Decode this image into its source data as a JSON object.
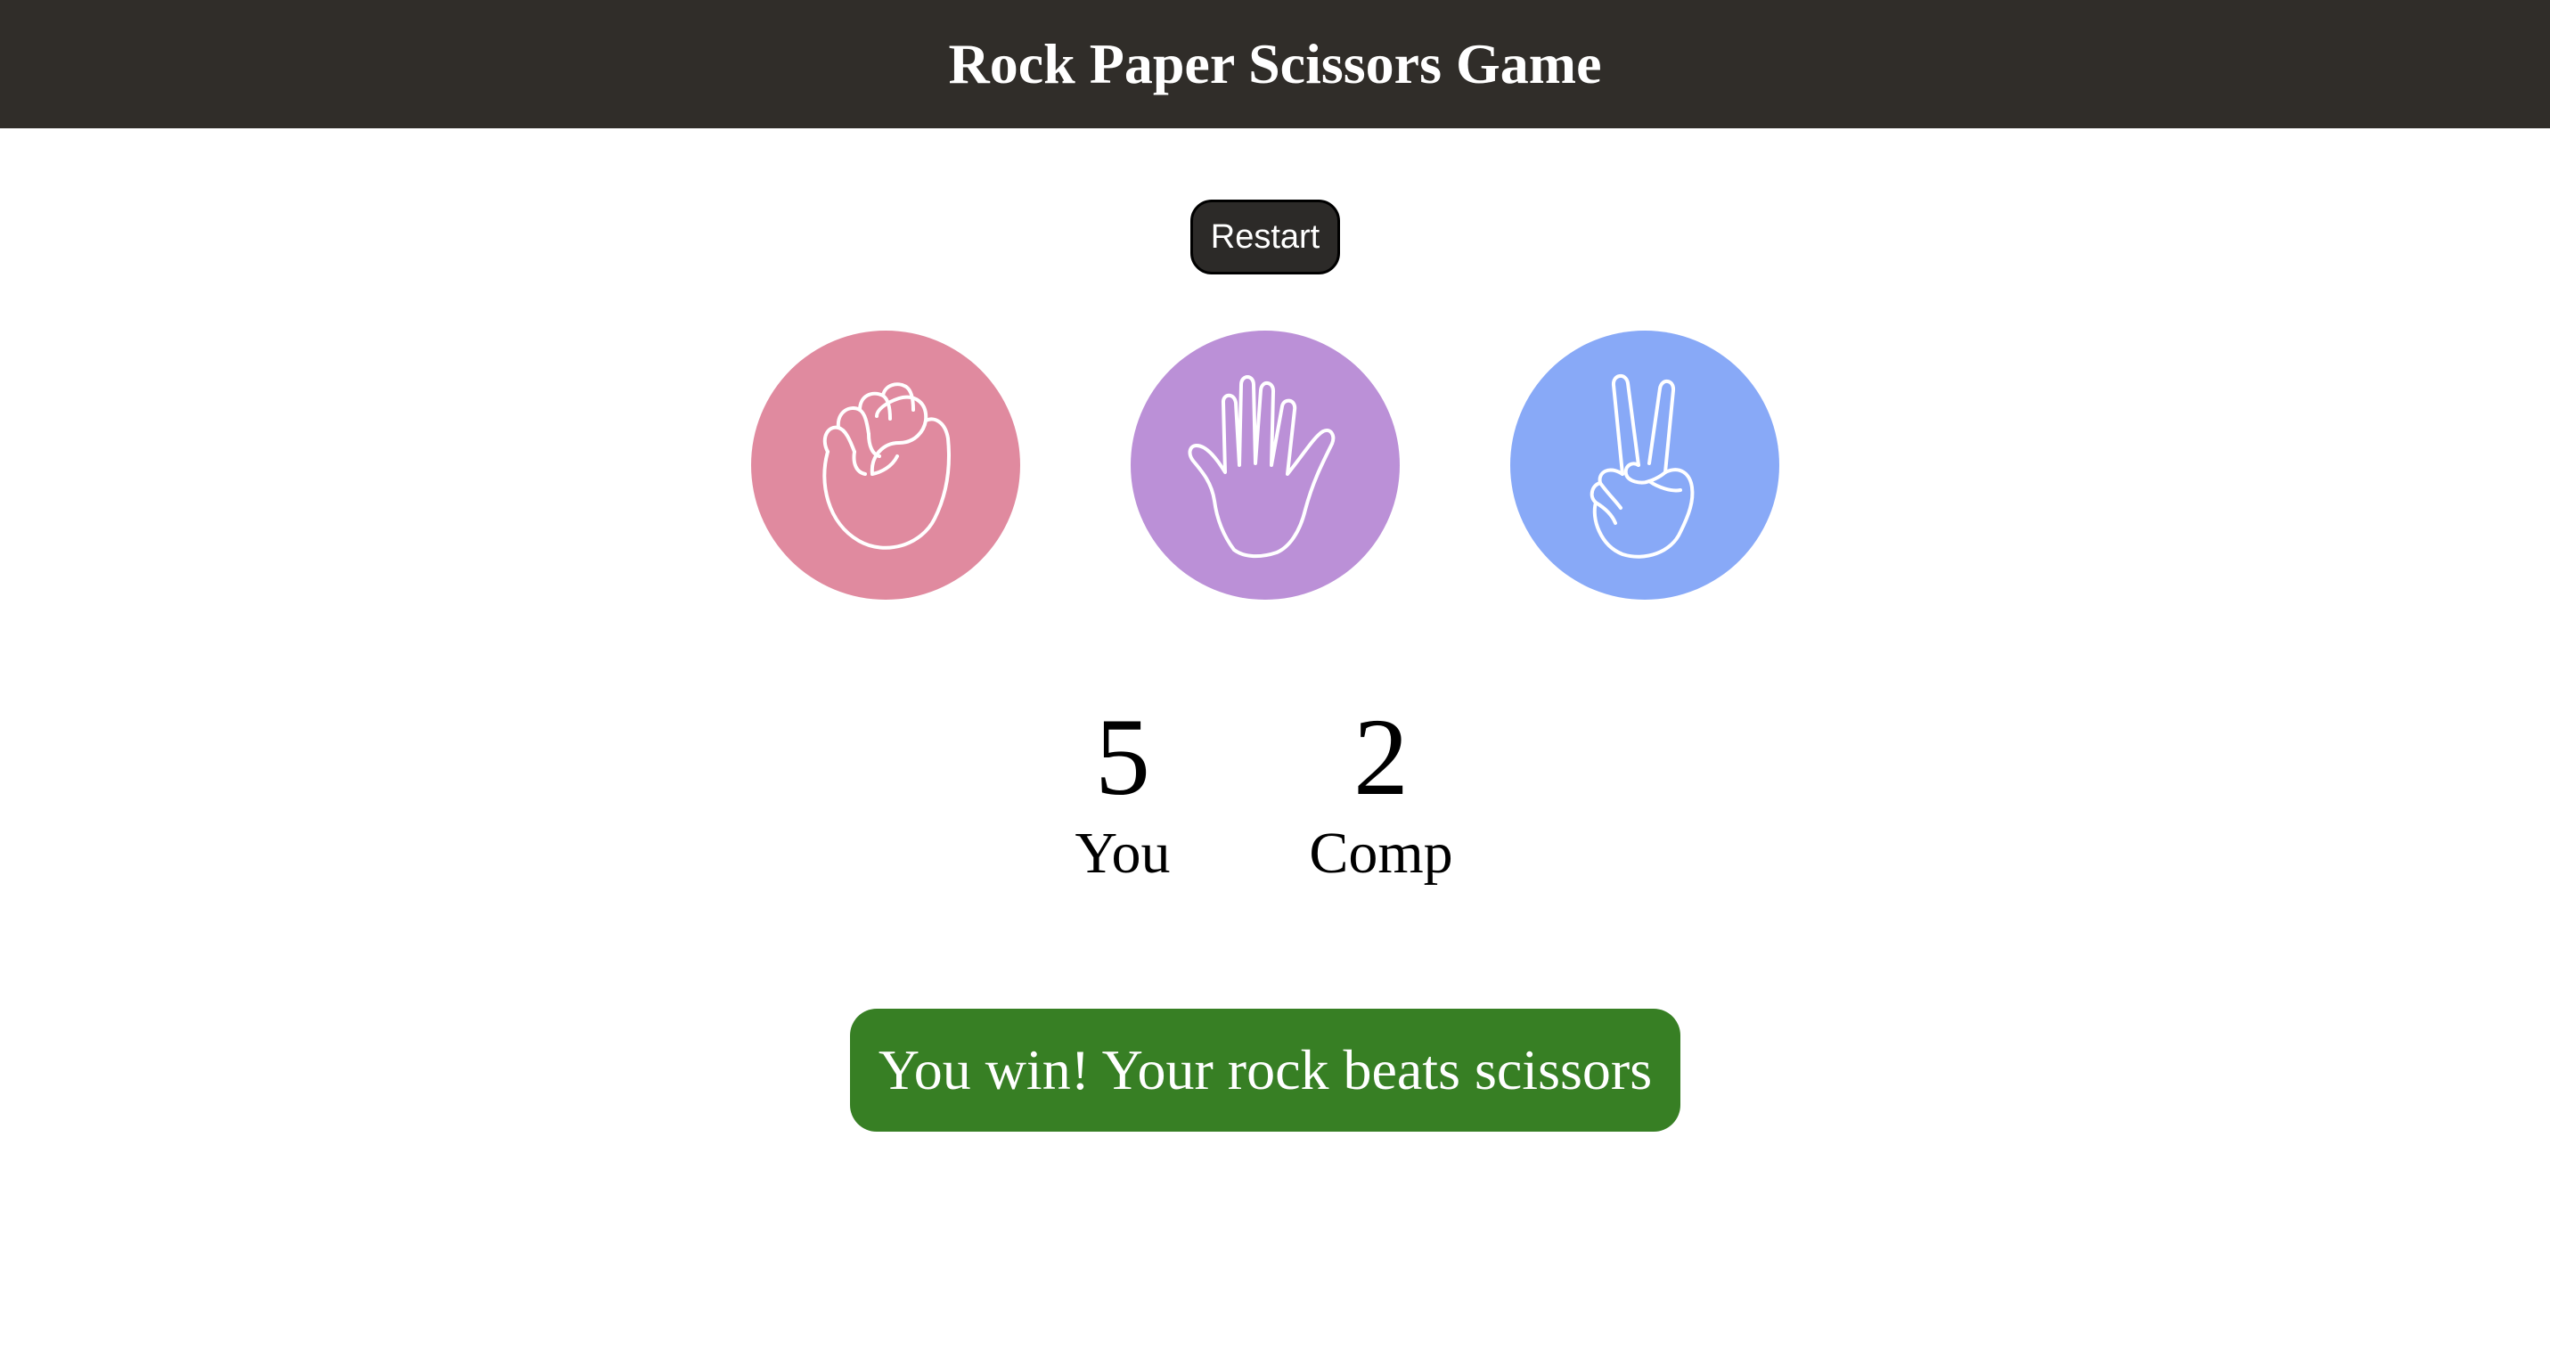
{
  "header": {
    "title": "Rock Paper Scissors Game"
  },
  "controls": {
    "restart_label": "Restart"
  },
  "choices": [
    {
      "id": "rock",
      "icon": "rock-fist-icon",
      "color": "#e08a9f"
    },
    {
      "id": "paper",
      "icon": "paper-hand-icon",
      "color": "#bb90d7"
    },
    {
      "id": "scissors",
      "icon": "scissors-hand-icon",
      "color": "#88a9f7"
    }
  ],
  "scoreboard": {
    "user": {
      "score": "5",
      "label": "You"
    },
    "comp": {
      "score": "2",
      "label": "Comp"
    }
  },
  "result": {
    "message": "You win! Your rock beats scissors",
    "color": "#377f24"
  },
  "colors": {
    "header_bg": "#302d29",
    "restart_bg": "#2c2a28"
  }
}
